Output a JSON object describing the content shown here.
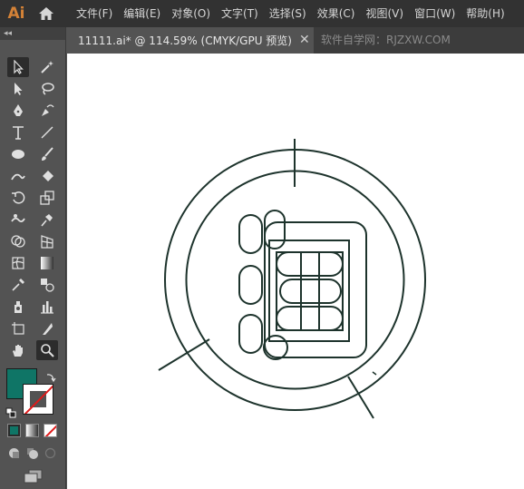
{
  "app": {
    "logo": "Ai"
  },
  "menu": [
    "文件(F)",
    "编辑(E)",
    "对象(O)",
    "文字(T)",
    "选择(S)",
    "效果(C)",
    "视图(V)",
    "窗口(W)",
    "帮助(H)"
  ],
  "toolbar": {
    "collapse_label": "◂◂"
  },
  "tab": {
    "title": "11111.ai* @ 114.59% (CMYK/GPU 预览)",
    "close": "✕"
  },
  "watermark": "软件自学网：RJZXW.COM",
  "colors": {
    "fill": "#0f7566",
    "stroke": "#ffffff",
    "artwork": "#1d332c",
    "brand": "#d48237"
  }
}
